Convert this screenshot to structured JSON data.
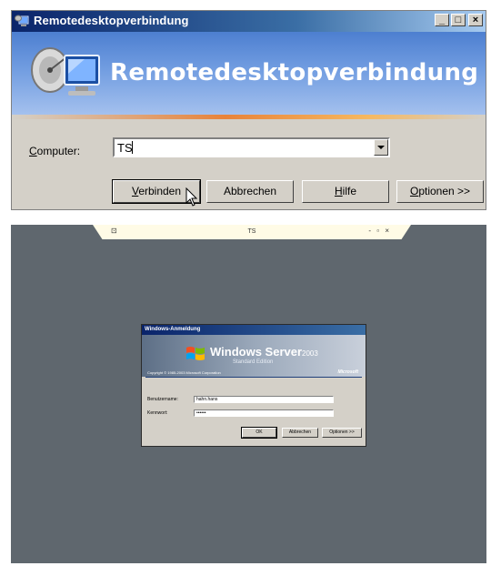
{
  "rdp_dialog": {
    "title": "Remotedesktopverbindung",
    "banner_title": "Remotedesktopverbindung",
    "computer_label_prefix": "C",
    "computer_label_rest": "omputer:",
    "computer_value": "TS",
    "buttons": {
      "connect_u": "V",
      "connect_rest": "erbinden",
      "cancel": "Abbrechen",
      "help_u": "H",
      "help_rest": "ilfe",
      "options_u": "O",
      "options_rest": "ptionen >>"
    },
    "window_controls": {
      "minimize": "_",
      "maximize": "□",
      "close": "×"
    }
  },
  "session": {
    "connection_bar_title": "TS",
    "connection_bar_controls": "- ▫ ×",
    "login": {
      "title": "Windows-Anmeldung",
      "product": "Windows Server",
      "year": "2003",
      "edition": "Standard Edition",
      "copyright": "Copyright © 1985-2003 Microsoft Corporation",
      "vendor": "Microsoft",
      "username_label": "Benutzername:",
      "username_value": "hahn.hans",
      "password_label": "Kennwort:",
      "password_value": "••••••",
      "ok": "OK",
      "cancel": "Abbrechen",
      "options": "Optionen >>"
    }
  }
}
